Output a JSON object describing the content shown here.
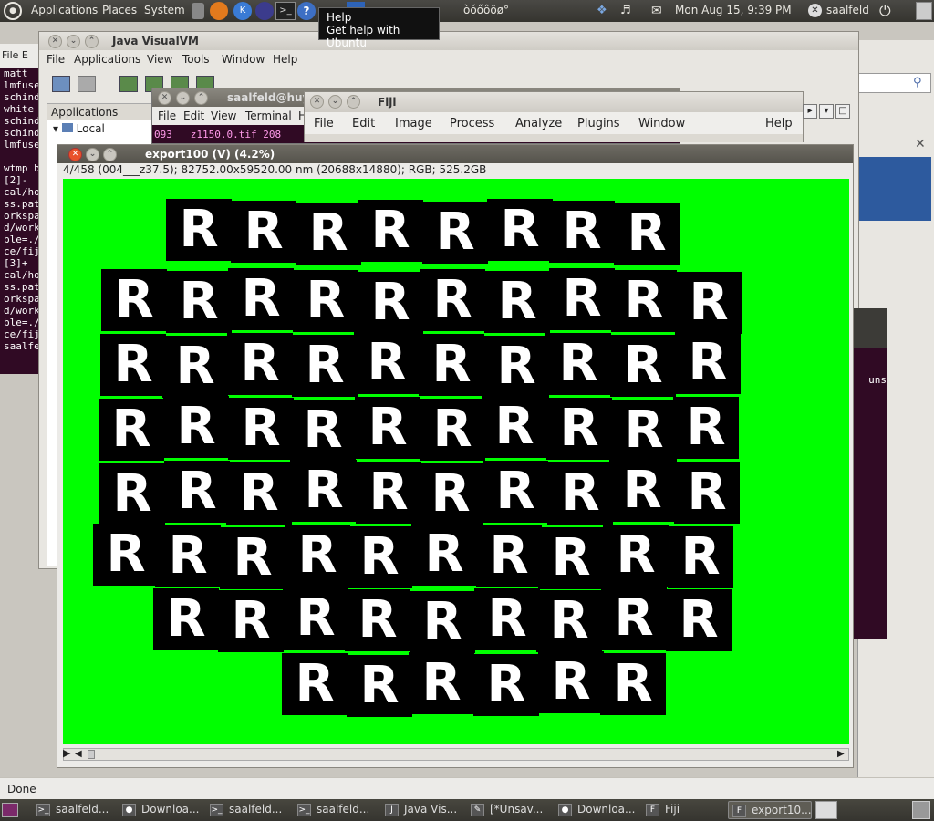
{
  "top_panel": {
    "menus": [
      "Applications",
      "Places",
      "System"
    ],
    "indicator_text": "òóőôöø°",
    "datetime": "Mon Aug 15,  9:39 PM",
    "user": "saalfeld"
  },
  "tooltip": {
    "title": "Help",
    "text": "Get help with Ubuntu"
  },
  "terminal_back": {
    "menu": [
      "File",
      "E"
    ],
    "lines": [
      "matt",
      "lmfuse",
      "schind",
      "white",
      "schind",
      "schind",
      "lmfuse",
      "",
      "wtmp b",
      "[2]-",
      "cal/ho",
      "ss.pat",
      "orkspa",
      "d/work",
      "ble=./",
      "ce/fij",
      "[3]+",
      "cal/ho",
      "ss.pat",
      "orkspa",
      "d/work",
      "ble=./",
      "ce/fij",
      "saalfe"
    ]
  },
  "visualvm": {
    "title": "Java VisualVM",
    "menu": [
      "File",
      "Applications",
      "View",
      "Tools",
      "Window",
      "Help"
    ],
    "applications_label": "Applications",
    "local_label": "Local"
  },
  "terminal_front": {
    "title": "saalfeld@huyg",
    "menu": [
      "File",
      "Edit",
      "View",
      "Terminal",
      "H"
    ],
    "line": "093___z1150.0.tif  208"
  },
  "fiji": {
    "title": "Fiji",
    "menu": [
      "File",
      "Edit",
      "Image",
      "Process",
      "Analyze",
      "Plugins",
      "Window",
      "Help"
    ]
  },
  "export_window": {
    "title": "export100 (V) (4.2%)",
    "info": "4/458 (004___z37.5); 82752.00x59520.00 nm (20688x14880); RGB; 525.2GB",
    "tile_letter": "R",
    "canvas_color": "#00ff00",
    "tile_rows": [
      8,
      10,
      10,
      10,
      10,
      10,
      9,
      6
    ]
  },
  "right_window": {
    "fragment": "uns"
  },
  "statusbar": {
    "text": "Done"
  },
  "taskbar": {
    "items": [
      {
        "label": "saalfeld...",
        "icon": "terminal-icon"
      },
      {
        "label": "Downloa...",
        "icon": "firefox-icon"
      },
      {
        "label": "saalfeld...",
        "icon": "terminal-icon"
      },
      {
        "label": "saalfeld...",
        "icon": "terminal-icon"
      },
      {
        "label": "Java Vis...",
        "icon": "java-icon"
      },
      {
        "label": "[*Unsav...",
        "icon": "editor-icon"
      },
      {
        "label": "Downloa...",
        "icon": "firefox-icon"
      },
      {
        "label": "Fiji",
        "icon": "fiji-icon"
      },
      {
        "label": "export10...",
        "icon": "fiji-icon",
        "active": true
      }
    ]
  }
}
